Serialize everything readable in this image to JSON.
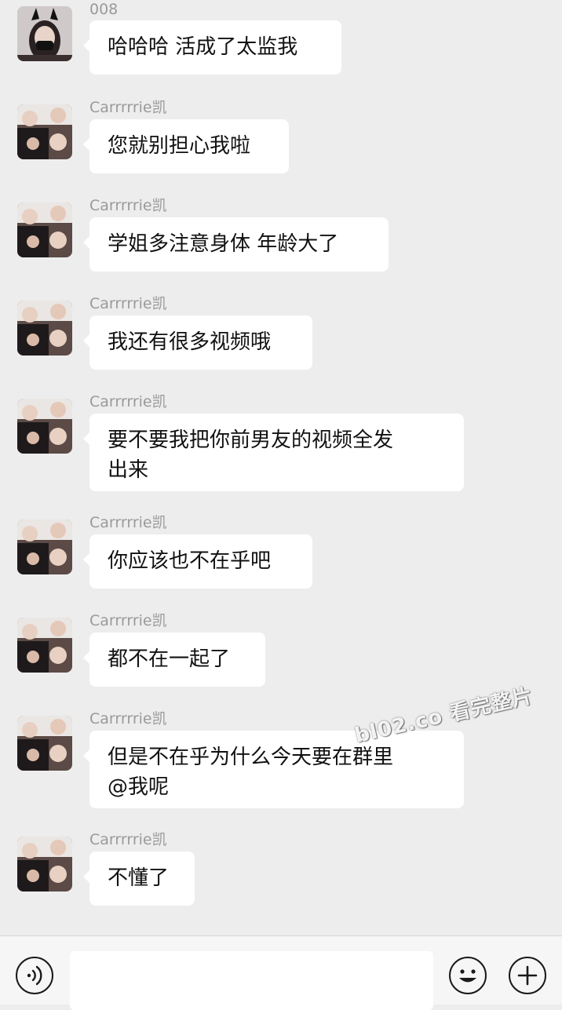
{
  "messages": [
    {
      "sender": "008",
      "text": "哈哈哈 活成了太监我",
      "avatar": "girl-bunny-ears-avatar"
    },
    {
      "sender": "Carrrrrie凯",
      "text": "您就别担心我啦",
      "avatar": "group-photo-avatar"
    },
    {
      "sender": "Carrrrrie凯",
      "text": "学姐多注意身体 年龄大了",
      "avatar": "group-photo-avatar"
    },
    {
      "sender": "Carrrrrie凯",
      "text": "我还有很多视频哦",
      "avatar": "group-photo-avatar"
    },
    {
      "sender": "Carrrrrie凯",
      "text": "要不要我把你前男友的视频全发\n出来",
      "avatar": "group-photo-avatar"
    },
    {
      "sender": "Carrrrrie凯",
      "text": "你应该也不在乎吧",
      "avatar": "group-photo-avatar"
    },
    {
      "sender": "Carrrrrie凯",
      "text": "都不在一起了",
      "avatar": "group-photo-avatar"
    },
    {
      "sender": "Carrrrrie凯",
      "text": "但是不在乎为什么今天要在群里\n@我呢",
      "avatar": "group-photo-avatar"
    },
    {
      "sender": "Carrrrrie凯",
      "text": "不懂了",
      "avatar": "group-photo-avatar"
    }
  ],
  "watermark": "bl02.co 看完整片",
  "input_bar": {
    "voice_icon": "voice-icon",
    "emoji_icon": "emoji-icon",
    "plus_icon": "plus-icon",
    "text_value": ""
  }
}
